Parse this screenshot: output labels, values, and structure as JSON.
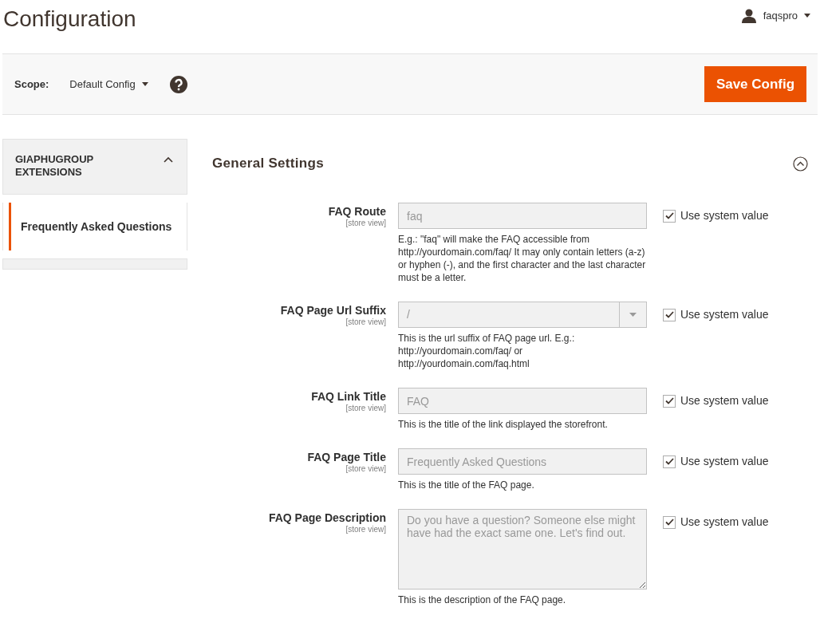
{
  "page_title": "Configuration",
  "user": {
    "name": "faqspro"
  },
  "scope": {
    "label": "Scope:",
    "value": "Default Config"
  },
  "save_button": "Save Config",
  "sidebar": {
    "group": {
      "title": "GIAPHUGROUP EXTENSIONS",
      "expanded": true
    },
    "items": [
      {
        "label": "Frequently Asked Questions",
        "selected": true
      }
    ]
  },
  "section": {
    "title": "General Settings",
    "expanded": true
  },
  "fields": [
    {
      "kind": "text",
      "label": "FAQ Route",
      "scope": "[store view]",
      "value": "faq",
      "hint": "E.g.: \"faq\" will make the FAQ accessible from http://yourdomain.com/faq/ It may only contain letters (a-z) or hyphen (-), and the first character and the last character must be a letter.",
      "system": {
        "label": "Use system value",
        "checked": true
      }
    },
    {
      "kind": "select",
      "label": "FAQ Page Url Suffix",
      "scope": "[store view]",
      "value": "/",
      "hint": "This is the url suffix of FAQ page url. E.g.: http://yourdomain.com/faq/ or http://yourdomain.com/faq.html",
      "system": {
        "label": "Use system value",
        "checked": true
      }
    },
    {
      "kind": "text",
      "label": "FAQ Link Title",
      "scope": "[store view]",
      "value": "FAQ",
      "hint": "This is the title of the link displayed the storefront.",
      "system": {
        "label": "Use system value",
        "checked": true
      }
    },
    {
      "kind": "text",
      "label": "FAQ Page Title",
      "scope": "[store view]",
      "value": "Frequently Asked Questions",
      "hint": "This is the title of the FAQ page.",
      "system": {
        "label": "Use system value",
        "checked": true
      }
    },
    {
      "kind": "textarea",
      "label": "FAQ Page Description",
      "scope": "[store view]",
      "value": "Do you have a question? Someone else might have had the exact same one. Let's find out.",
      "hint": "This is the description of the FAQ page.",
      "system": {
        "label": "Use system value",
        "checked": true
      }
    }
  ]
}
